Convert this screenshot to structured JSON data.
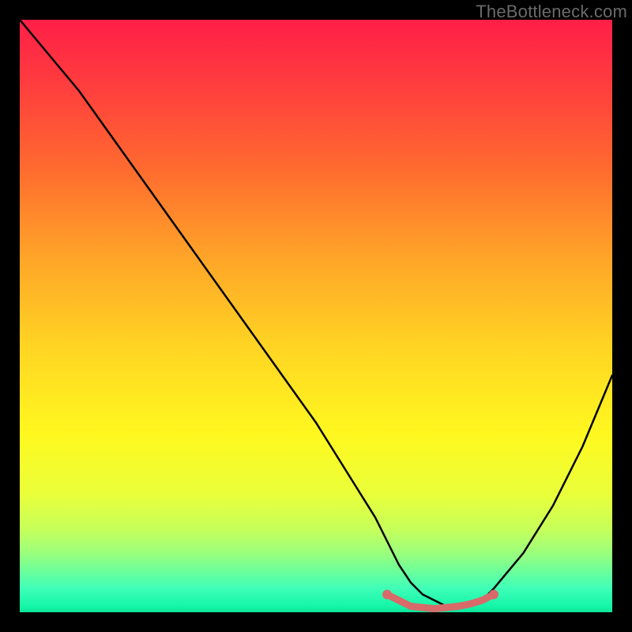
{
  "watermark": {
    "text": "TheBottleneck.com"
  },
  "chart_data": {
    "type": "line",
    "title": "",
    "xlabel": "",
    "ylabel": "",
    "xlim": [
      0,
      100
    ],
    "ylim": [
      0,
      100
    ],
    "grid": false,
    "legend": false,
    "series": [
      {
        "name": "bottleneck-curve",
        "x": [
          0,
          5,
          10,
          15,
          20,
          25,
          30,
          35,
          40,
          45,
          50,
          55,
          60,
          62,
          64,
          66,
          68,
          70,
          72,
          74,
          76,
          78,
          80,
          85,
          90,
          95,
          100
        ],
        "y": [
          100,
          94,
          88,
          81,
          74,
          67,
          60,
          53,
          46,
          39,
          32,
          24,
          16,
          12,
          8,
          5,
          3,
          2,
          1,
          1,
          1,
          2,
          4,
          10,
          18,
          28,
          40
        ]
      }
    ],
    "highlight_segment": {
      "name": "optimal-range",
      "color": "#d86a6a",
      "x": [
        62,
        64,
        66,
        68,
        70,
        72,
        74,
        76,
        78,
        80
      ],
      "y": [
        3,
        2,
        1,
        0.8,
        0.6,
        0.8,
        1,
        1.4,
        2,
        3
      ]
    },
    "highlight_endpoints": {
      "name": "optimal-range-dots",
      "color": "#d86a6a",
      "points": [
        {
          "x": 62,
          "y": 3
        },
        {
          "x": 80,
          "y": 3
        }
      ]
    },
    "background": {
      "type": "vertical-gradient",
      "stops": [
        {
          "pos": 0,
          "color": "#ff1f47"
        },
        {
          "pos": 25,
          "color": "#ff6a2f"
        },
        {
          "pos": 55,
          "color": "#ffd423"
        },
        {
          "pos": 80,
          "color": "#eaff3a"
        },
        {
          "pos": 100,
          "color": "#0de59a"
        }
      ]
    }
  }
}
